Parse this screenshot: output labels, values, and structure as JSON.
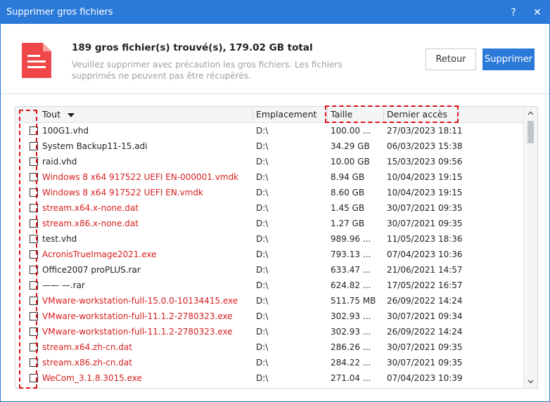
{
  "window": {
    "title": "Supprimer gros fichiers",
    "help_glyph": "?",
    "close_glyph": "✕"
  },
  "header": {
    "icon": "file-document-icon",
    "count_text": "189 gros fichier(s) trouvé(s),",
    "total_text": "179.02 GB total",
    "warning": "Veuillez supprimer avec précaution les gros fichiers. Les fichiers supprimés ne peuvent pas être récupérés."
  },
  "buttons": {
    "back": "Retour",
    "delete": "Supprimer"
  },
  "table": {
    "columns": {
      "all": "Tout",
      "location": "Emplacement",
      "size": "Taille",
      "last_access": "Dernier accès"
    },
    "rows": [
      {
        "name": "100G1.vhd",
        "location": "D:\\",
        "size": "100.00 ...",
        "date": "27/03/2023 18:11",
        "red": false
      },
      {
        "name": "System Backup11-15.adi",
        "location": "D:\\",
        "size": "34.29 GB",
        "date": "06/03/2023 15:38",
        "red": false
      },
      {
        "name": "raid.vhd",
        "location": "D:\\",
        "size": "10.00 GB",
        "date": "15/03/2023 09:56",
        "red": false
      },
      {
        "name": "Windows 8 x64 917522 UEFI EN-000001.vmdk",
        "location": "D:\\",
        "size": "8.94 GB",
        "date": "10/04/2023 19:15",
        "red": true
      },
      {
        "name": "Windows 8 x64 917522 UEFI EN.vmdk",
        "location": "D:\\",
        "size": "8.60 GB",
        "date": "10/04/2023 19:15",
        "red": true
      },
      {
        "name": "stream.x64.x-none.dat",
        "location": "D:\\",
        "size": "1.45 GB",
        "date": "30/07/2021 09:35",
        "red": true
      },
      {
        "name": "stream.x86.x-none.dat",
        "location": "D:\\",
        "size": "1.27 GB",
        "date": "30/07/2021 09:35",
        "red": true
      },
      {
        "name": "test.vhd",
        "location": "D:\\",
        "size": "989.96 ...",
        "date": "11/05/2023 18:36",
        "red": false
      },
      {
        "name": "AcronisTrueImage2021.exe",
        "location": "D:\\",
        "size": "793.13 ...",
        "date": "07/04/2023 10:36",
        "red": true
      },
      {
        "name": "Office2007 proPLUS.rar",
        "location": "D:\\",
        "size": "633.47 ...",
        "date": "21/06/2021 14:57",
        "red": false
      },
      {
        "name": "——                        —.rar",
        "location": "D:\\",
        "size": "624.82 ...",
        "date": "17/05/2022 16:57",
        "red": false
      },
      {
        "name": "VMware-workstation-full-15.0.0-10134415.exe",
        "location": "D:\\",
        "size": "511.75 MB",
        "date": "26/09/2022 14:24",
        "red": true
      },
      {
        "name": "VMware-workstation-full-11.1.2-2780323.exe",
        "location": "D:\\",
        "size": "302.93 ...",
        "date": "30/07/2021 09:34",
        "red": true
      },
      {
        "name": "VMware-workstation-full-11.1.2-2780323.exe",
        "location": "D:\\",
        "size": "302.93 ...",
        "date": "26/09/2022 14:24",
        "red": true
      },
      {
        "name": "stream.x64.zh-cn.dat",
        "location": "D:\\",
        "size": "286.26 ...",
        "date": "30/07/2021 09:35",
        "red": true
      },
      {
        "name": "stream.x86.zh-cn.dat",
        "location": "D:\\",
        "size": "284.22 ...",
        "date": "30/07/2021 09:35",
        "red": true
      },
      {
        "name": "WeCom_3.1.8.3015.exe",
        "location": "D:\\",
        "size": "271.04 ...",
        "date": "07/04/2023 10:39",
        "red": true
      }
    ]
  },
  "colors": {
    "accent": "#2b79d8",
    "highlight_red": "#d61e1e",
    "annotation_red": "#e01010"
  }
}
